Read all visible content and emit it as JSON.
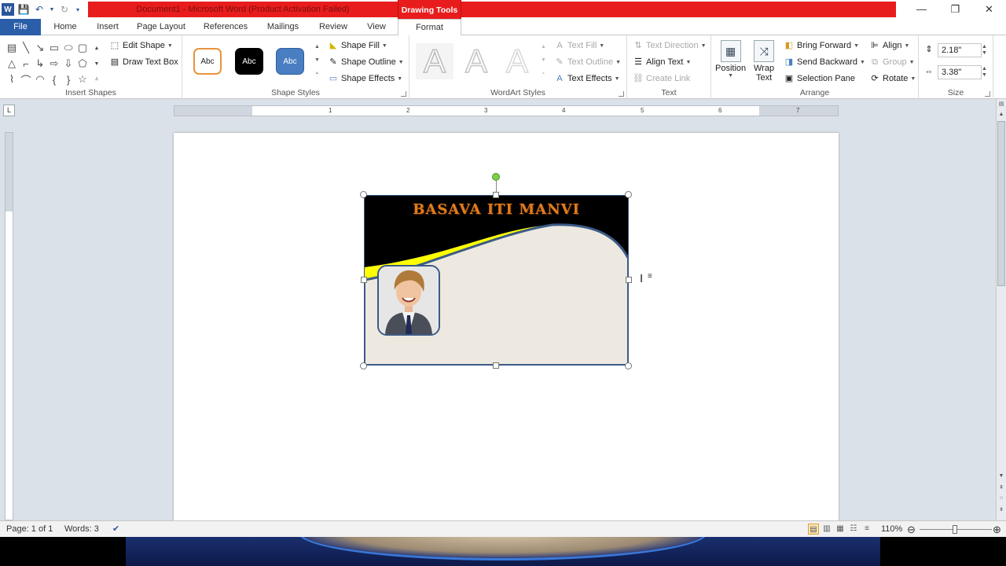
{
  "titlebar": {
    "document_title": "Document1 - Microsoft Word (Product Activation Failed)",
    "context_tab_header": "Drawing Tools",
    "window_controls": [
      "—",
      "❐",
      "✕"
    ]
  },
  "tabs": [
    "File",
    "Home",
    "Insert",
    "Page Layout",
    "References",
    "Mailings",
    "Review",
    "View",
    "Format"
  ],
  "ribbon": {
    "insert_shapes": {
      "label": "Insert Shapes",
      "edit_shape": "Edit Shape",
      "draw_text_box": "Draw Text Box"
    },
    "shape_styles": {
      "label": "Shape Styles",
      "swatches": [
        "Abc",
        "Abc",
        "Abc"
      ],
      "shape_fill": "Shape Fill",
      "shape_outline": "Shape Outline",
      "shape_effects": "Shape Effects"
    },
    "wordart_styles": {
      "label": "WordArt Styles",
      "letters": [
        "A",
        "A",
        "A"
      ],
      "text_fill": "Text Fill",
      "text_outline": "Text Outline",
      "text_effects": "Text Effects"
    },
    "text": {
      "label": "Text",
      "text_direction": "Text Direction",
      "align_text": "Align Text",
      "create_link": "Create Link"
    },
    "arrange": {
      "label": "Arrange",
      "position": "Position",
      "wrap_text_line1": "Wrap",
      "wrap_text_line2": "Text",
      "bring_forward": "Bring Forward",
      "send_backward": "Send Backward",
      "selection_pane": "Selection Pane",
      "align": "Align",
      "group": "Group",
      "rotate": "Rotate"
    },
    "size": {
      "label": "Size",
      "height": "2.18\"",
      "width": "3.38\""
    }
  },
  "ruler": {
    "corner": "L",
    "numbers": [
      "1",
      "2",
      "3",
      "4",
      "5",
      "6",
      "7"
    ]
  },
  "card": {
    "title": "BASAVA ITI MANVI"
  },
  "statusbar": {
    "page": "Page: 1 of 1",
    "words": "Words: 3",
    "zoom": "110%"
  },
  "colors": {
    "file_tab": "#2a5ea8",
    "title_bar_red": "#e81c1c",
    "card_header": "#000000",
    "card_stripe": "#ffff00",
    "card_body": "#ede9e1",
    "card_border": "#3b5a86",
    "card_title": "#e07a1e"
  }
}
